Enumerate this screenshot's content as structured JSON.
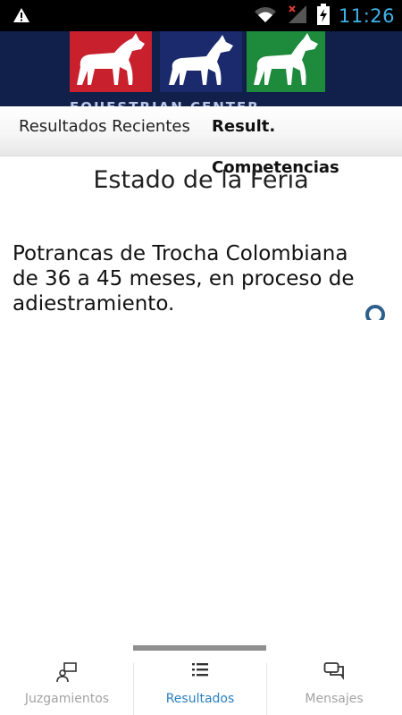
{
  "status_bar": {
    "time": "11:26",
    "icons": [
      "warning-icon",
      "wifi-icon",
      "no-signal-icon",
      "battery-charging-icon"
    ]
  },
  "banner": {
    "brand": "EQUESTRIAN CENTER",
    "panel_colors": [
      "#c8202d",
      "#1a2a6c",
      "#1e8a3c"
    ]
  },
  "tabs": [
    {
      "label": "Resultados Recientes",
      "selected": false
    },
    {
      "label": "Result. Competencias",
      "selected": true
    }
  ],
  "main": {
    "fair_status_title": "Estado de la Feria",
    "category_text": "Potrancas de Trocha Colombiana de 36 a 45 meses, en proceso de adiestramiento."
  },
  "bottom_nav": {
    "items": [
      {
        "label": "Juzgamientos",
        "icon": "judge-icon",
        "active": false
      },
      {
        "label": "Resultados",
        "icon": "list-icon",
        "active": true
      },
      {
        "label": "Mensajes",
        "icon": "chat-icon",
        "active": false
      }
    ]
  },
  "colors": {
    "accent": "#2b7fc0",
    "status_icons": "#3fb3e8",
    "banner_bg": "#10204a"
  }
}
